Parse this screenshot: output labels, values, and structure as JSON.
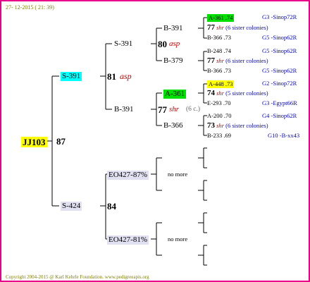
{
  "date": "27- 12-2015 ( 21: 39)",
  "footer": "Copyright 2004-2015 @ Karl Kehrle Foundation.   www.pedigreeapis.org",
  "queen": {
    "label": "JJ103",
    "score": "87"
  },
  "gen1": {
    "sire": {
      "label": "S-391",
      "score": "81",
      "type": "asp"
    },
    "dam": {
      "label": "S-424",
      "score": "84"
    }
  },
  "gen2": {
    "a": {
      "label": "S-391",
      "score": "80",
      "type": "asp"
    },
    "b": {
      "label": "B-391",
      "score": "77",
      "type": "shr",
      "note": "(6 c.)"
    },
    "c": {
      "label": "EO427-87%",
      "note": "no more"
    },
    "d": {
      "label": "EO427-81%",
      "note": "no more"
    }
  },
  "gen3": {
    "a1": {
      "label": "B-391"
    },
    "a2": {
      "label": "B-379"
    },
    "b1": {
      "label": "A-361"
    },
    "b2": {
      "label": "B-366"
    }
  },
  "gen4": [
    {
      "id": "A-361 .74",
      "origin": "G3 -Sinop72R"
    },
    {
      "score": "77",
      "type": "shr",
      "note": "(6 sister colonies)"
    },
    {
      "id": "B-366 .73",
      "origin": "G5 -Sinop62R"
    },
    {
      "id": "B-248 .74",
      "origin": "G5 -Sinop62R"
    },
    {
      "score": "77",
      "type": "shr",
      "note": "(6 sister colonies)"
    },
    {
      "id": "B-366 .73",
      "origin": "G5 -Sinop62R"
    },
    {
      "id": "A-448 .73",
      "origin": "G2 -Sinop72R"
    },
    {
      "score": "74",
      "type": "shr",
      "note": "(5 sister colonies)"
    },
    {
      "id": "E-293 .70",
      "origin": "G3 -Egypt66R"
    },
    {
      "id": "A-200 .70",
      "origin": "G4 -Sinop62R"
    },
    {
      "score": "73",
      "type": "shr",
      "note": "(6 sister colonies)"
    },
    {
      "id": "B-233 .69",
      "origin": "G10 -B-xx43"
    }
  ]
}
